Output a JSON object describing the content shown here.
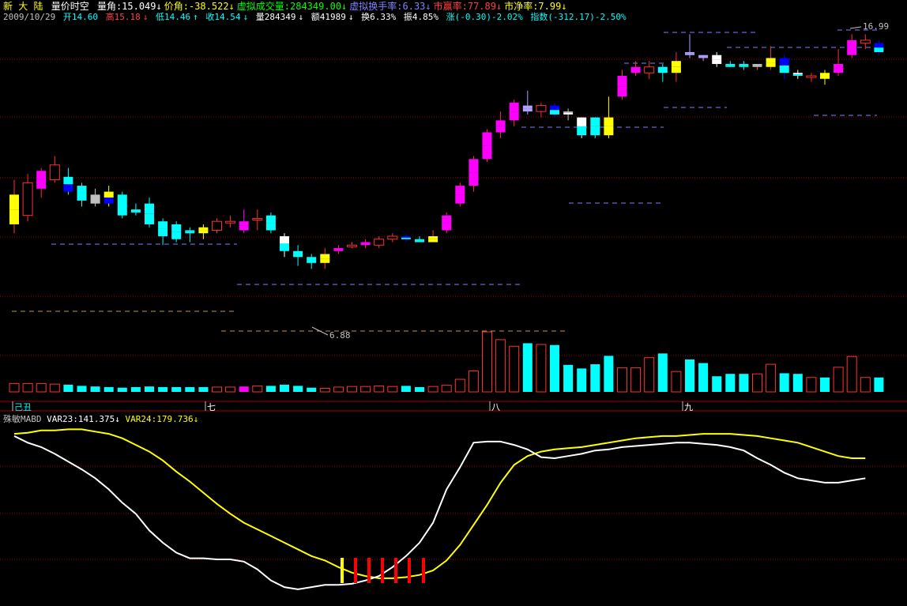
{
  "header": {
    "stock_name": "新 大 陆",
    "indicator_name": "量价时空",
    "items": [
      {
        "label": "量角:",
        "value": "15.049",
        "arrow": "↓",
        "color": "#ffffff"
      },
      {
        "label": "价角:",
        "value": "-38.522",
        "arrow": "↓",
        "color": "#ffff00"
      },
      {
        "label": "虚拟成交量:",
        "value": "284349.00",
        "arrow": "↓",
        "color": "#00ff00"
      },
      {
        "label": "虚拟换手率:",
        "value": "6.33",
        "arrow": "↓",
        "color": "#8080ff"
      },
      {
        "label": "市赢率:",
        "value": "77.89",
        "arrow": "↓",
        "color": "#ff4040"
      },
      {
        "label": "市净率:",
        "value": "7.99",
        "arrow": "↓",
        "color": "#ffff00"
      }
    ]
  },
  "quote": {
    "date": "2009/10/29",
    "open": "开14.60",
    "high": "高15.18",
    "low": "低14.46",
    "close": "收14.54",
    "volume": "量284349",
    "amount": "额41989",
    "turnover": "换6.33%",
    "amplitude": "振4.85%",
    "change": "涨(-0.30)-2.02%",
    "index": "指数(-312.17)-2.50%"
  },
  "price_labels": {
    "low": "6.88",
    "high": "16.99"
  },
  "month_labels": [
    "己丑",
    "七",
    "八",
    "九"
  ],
  "indicator": {
    "name": "殊敏MABD",
    "var23": "VAR23:141.375",
    "var23_arrow": "↓",
    "var24": "VAR24:179.736",
    "var24_arrow": "↓"
  },
  "colors": {
    "up": "#ff3030",
    "cyan": "#00ffff",
    "magenta": "#ff00ff",
    "yellow": "#ffff00",
    "blue": "#0000ff",
    "grid": "#a00000",
    "white": "#ffffff"
  },
  "chart_data": {
    "type": "candlestick",
    "candles": [
      {
        "o": 10.5,
        "c": 11.5,
        "h": 12.0,
        "l": 10.2,
        "col": "up_yellow"
      },
      {
        "o": 10.8,
        "c": 11.9,
        "h": 12.2,
        "l": 10.6,
        "col": "up"
      },
      {
        "o": 11.7,
        "c": 12.3,
        "h": 12.4,
        "l": 11.4,
        "col": "magenta"
      },
      {
        "o": 12.0,
        "c": 12.5,
        "h": 12.8,
        "l": 11.9,
        "col": "up"
      },
      {
        "o": 12.1,
        "c": 11.6,
        "h": 12.4,
        "l": 11.5,
        "col": "cyan_blue"
      },
      {
        "o": 11.8,
        "c": 11.3,
        "h": 11.9,
        "l": 11.1,
        "col": "cyan"
      },
      {
        "o": 11.5,
        "c": 11.2,
        "h": 11.7,
        "l": 11.1,
        "col": "gray"
      },
      {
        "o": 11.6,
        "c": 11.2,
        "h": 11.8,
        "l": 11.1,
        "col": "yellow_blue"
      },
      {
        "o": 11.5,
        "c": 10.8,
        "h": 11.6,
        "l": 10.7,
        "col": "cyan"
      },
      {
        "o": 11.0,
        "c": 10.9,
        "h": 11.2,
        "l": 10.8,
        "col": "cyan"
      },
      {
        "o": 11.2,
        "c": 10.5,
        "h": 11.4,
        "l": 10.4,
        "col": "cyan"
      },
      {
        "o": 10.6,
        "c": 10.1,
        "h": 10.7,
        "l": 9.8,
        "col": "cyan"
      },
      {
        "o": 10.5,
        "c": 10.0,
        "h": 10.6,
        "l": 9.9,
        "col": "cyan"
      },
      {
        "o": 10.3,
        "c": 10.2,
        "h": 10.4,
        "l": 9.9,
        "col": "cyan"
      },
      {
        "o": 10.4,
        "c": 10.2,
        "h": 10.5,
        "l": 10.0,
        "col": "up_yellow"
      },
      {
        "o": 10.3,
        "c": 10.6,
        "h": 10.7,
        "l": 10.2,
        "col": "up"
      },
      {
        "o": 10.6,
        "c": 10.6,
        "h": 10.8,
        "l": 10.4,
        "col": "up"
      },
      {
        "o": 10.6,
        "c": 10.3,
        "h": 11.0,
        "l": 10.2,
        "col": "magenta"
      },
      {
        "o": 10.7,
        "c": 10.7,
        "h": 11.0,
        "l": 10.3,
        "col": "up"
      },
      {
        "o": 10.8,
        "c": 10.3,
        "h": 10.9,
        "l": 10.2,
        "col": "cyan"
      },
      {
        "o": 10.1,
        "c": 9.6,
        "h": 10.2,
        "l": 9.4,
        "col": "white_cyan"
      },
      {
        "o": 9.6,
        "c": 9.4,
        "h": 9.8,
        "l": 9.1,
        "col": "cyan"
      },
      {
        "o": 9.4,
        "c": 9.2,
        "h": 9.5,
        "l": 9.0,
        "col": "cyan"
      },
      {
        "o": 9.2,
        "c": 9.5,
        "h": 9.7,
        "l": 9.0,
        "col": "yellow_up"
      },
      {
        "o": 9.6,
        "c": 9.7,
        "h": 9.8,
        "l": 9.5,
        "col": "magenta"
      },
      {
        "o": 9.8,
        "c": 9.8,
        "h": 9.9,
        "l": 9.7,
        "col": "up"
      },
      {
        "o": 9.8,
        "c": 9.9,
        "h": 10.0,
        "l": 9.7,
        "col": "magenta"
      },
      {
        "o": 9.8,
        "c": 10.0,
        "h": 10.1,
        "l": 9.7,
        "col": "up"
      },
      {
        "o": 10.0,
        "c": 10.1,
        "h": 10.2,
        "l": 9.9,
        "col": "up"
      },
      {
        "o": 10.1,
        "c": 10.0,
        "h": 10.2,
        "l": 9.9,
        "col": "blue_cyan"
      },
      {
        "o": 10.0,
        "c": 9.9,
        "h": 10.1,
        "l": 9.9,
        "col": "cyan"
      },
      {
        "o": 9.9,
        "c": 10.1,
        "h": 10.3,
        "l": 9.9,
        "col": "yellow_up"
      },
      {
        "o": 10.3,
        "c": 10.8,
        "h": 10.9,
        "l": 10.2,
        "col": "magenta"
      },
      {
        "o": 11.2,
        "c": 11.8,
        "h": 11.9,
        "l": 11.1,
        "col": "magenta"
      },
      {
        "o": 11.8,
        "c": 12.7,
        "h": 12.8,
        "l": 11.6,
        "col": "magenta"
      },
      {
        "o": 12.7,
        "c": 13.6,
        "h": 13.7,
        "l": 12.6,
        "col": "magenta"
      },
      {
        "o": 13.6,
        "c": 14.0,
        "h": 14.3,
        "l": 13.4,
        "col": "magenta"
      },
      {
        "o": 14.0,
        "c": 14.6,
        "h": 14.7,
        "l": 13.8,
        "col": "magenta"
      },
      {
        "o": 14.5,
        "c": 14.3,
        "h": 15.0,
        "l": 14.2,
        "col": "lavender"
      },
      {
        "o": 14.3,
        "c": 14.5,
        "h": 14.6,
        "l": 14.1,
        "col": "up"
      },
      {
        "o": 14.5,
        "c": 14.2,
        "h": 14.6,
        "l": 14.1,
        "col": "blue_cyan"
      },
      {
        "o": 14.3,
        "c": 14.2,
        "h": 14.4,
        "l": 14.0,
        "col": "gray_white"
      },
      {
        "o": 14.1,
        "c": 13.5,
        "h": 14.1,
        "l": 13.4,
        "col": "white_cyan"
      },
      {
        "o": 14.1,
        "c": 13.5,
        "h": 14.1,
        "l": 13.4,
        "col": "cyan"
      },
      {
        "o": 14.1,
        "c": 13.5,
        "h": 14.8,
        "l": 13.4,
        "col": "yellow_up"
      },
      {
        "o": 14.8,
        "c": 15.5,
        "h": 15.7,
        "l": 14.7,
        "col": "magenta"
      },
      {
        "o": 15.6,
        "c": 15.8,
        "h": 16.0,
        "l": 15.5,
        "col": "magenta"
      },
      {
        "o": 15.8,
        "c": 15.6,
        "h": 16.0,
        "l": 15.4,
        "col": "up"
      },
      {
        "o": 15.8,
        "c": 15.6,
        "h": 15.9,
        "l": 15.3,
        "col": "cyan"
      },
      {
        "o": 15.6,
        "c": 16.0,
        "h": 16.3,
        "l": 15.3,
        "col": "yellow_up"
      },
      {
        "o": 16.3,
        "c": 16.2,
        "h": 16.9,
        "l": 16.1,
        "col": "lavender"
      },
      {
        "o": 16.2,
        "c": 16.1,
        "h": 16.2,
        "l": 16.0,
        "col": "lavender"
      },
      {
        "o": 16.2,
        "c": 15.9,
        "h": 16.3,
        "l": 15.8,
        "col": "white"
      },
      {
        "o": 15.9,
        "c": 15.8,
        "h": 16.0,
        "l": 15.8,
        "col": "cyan"
      },
      {
        "o": 15.9,
        "c": 15.8,
        "h": 16.0,
        "l": 15.7,
        "col": "cyan"
      },
      {
        "o": 15.8,
        "c": 15.9,
        "h": 15.9,
        "l": 15.7,
        "col": "gray"
      },
      {
        "o": 15.8,
        "c": 16.1,
        "h": 16.5,
        "l": 15.7,
        "col": "yellow_up"
      },
      {
        "o": 16.1,
        "c": 15.6,
        "h": 16.2,
        "l": 15.4,
        "col": "blue_cyan"
      },
      {
        "o": 15.6,
        "c": 15.5,
        "h": 15.7,
        "l": 15.4,
        "col": "white_cyan"
      },
      {
        "o": 15.5,
        "c": 15.5,
        "h": 15.6,
        "l": 15.3,
        "col": "up"
      },
      {
        "o": 15.6,
        "c": 15.4,
        "h": 15.7,
        "l": 15.2,
        "col": "yellow_up"
      },
      {
        "o": 15.6,
        "c": 15.9,
        "h": 16.4,
        "l": 15.5,
        "col": "magenta"
      },
      {
        "o": 16.2,
        "c": 16.7,
        "h": 16.9,
        "l": 16.1,
        "col": "magenta"
      },
      {
        "o": 16.7,
        "c": 16.6,
        "h": 16.9,
        "l": 16.4,
        "col": "up"
      },
      {
        "o": 16.6,
        "c": 16.3,
        "h": 16.7,
        "l": 16.2,
        "col": "blue_cyan"
      }
    ],
    "volumes": [
      0.14,
      0.14,
      0.14,
      0.13,
      0.12,
      0.1,
      0.09,
      0.08,
      0.07,
      0.08,
      0.09,
      0.08,
      0.08,
      0.08,
      0.08,
      0.08,
      0.08,
      0.09,
      0.1,
      0.1,
      0.12,
      0.1,
      0.07,
      0.06,
      0.08,
      0.09,
      0.09,
      0.1,
      0.09,
      0.1,
      0.08,
      0.09,
      0.11,
      0.21,
      0.35,
      1.0,
      0.87,
      0.76,
      0.81,
      0.79,
      0.78,
      0.45,
      0.39,
      0.46,
      0.6,
      0.4,
      0.4,
      0.57,
      0.64,
      0.34,
      0.54,
      0.48,
      0.26,
      0.3,
      0.3,
      0.3,
      0.46,
      0.31,
      0.3,
      0.24,
      0.24,
      0.41,
      0.59,
      0.24,
      0.24
    ],
    "var23": [
      188,
      182,
      178,
      172,
      165,
      158,
      150,
      140,
      128,
      118,
      103,
      92,
      83,
      78,
      78,
      77,
      77,
      75,
      68,
      58,
      52,
      50,
      52,
      54,
      54,
      55,
      58,
      62,
      70,
      80,
      92,
      110,
      140,
      160,
      182,
      183,
      183,
      180,
      176,
      169,
      168,
      170,
      172,
      175,
      176,
      178,
      179,
      180,
      181,
      182,
      182,
      181,
      180,
      178,
      175,
      168,
      162,
      155,
      150,
      148,
      146,
      146,
      148,
      150
    ],
    "var24": [
      190,
      191,
      193,
      193,
      194,
      194,
      192,
      190,
      186,
      180,
      174,
      166,
      156,
      147,
      137,
      127,
      118,
      110,
      104,
      98,
      92,
      86,
      80,
      76,
      70,
      65,
      62,
      60,
      60,
      61,
      63,
      67,
      76,
      90,
      108,
      126,
      146,
      162,
      170,
      174,
      176,
      177,
      178,
      180,
      182,
      184,
      186,
      187,
      188,
      188,
      189,
      190,
      190,
      190,
      189,
      188,
      186,
      184,
      182,
      178,
      174,
      170,
      168,
      168
    ]
  }
}
